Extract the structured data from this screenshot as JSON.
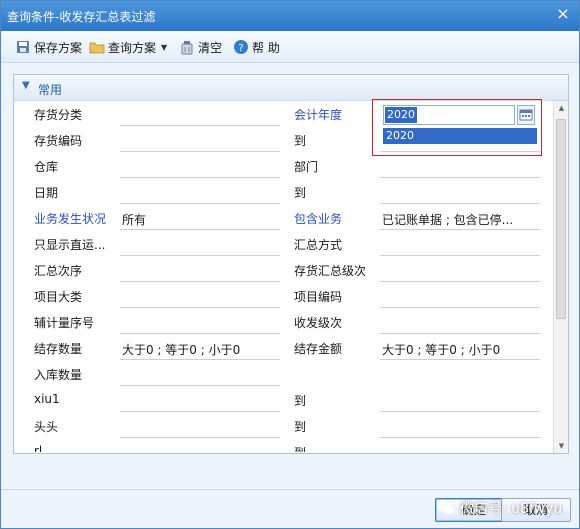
{
  "window": {
    "title": "查询条件-收发存汇总表过滤",
    "close_glyph": "×"
  },
  "toolbar": {
    "save_scheme": "保存方案",
    "query_scheme": "查询方案",
    "clear": "清空",
    "help": "帮 助"
  },
  "panel": {
    "title": "常用",
    "rows": [
      {
        "left_label": "存货分类",
        "left_value": "",
        "right_label": "会计年度",
        "right_value": "",
        "right_blue": true
      },
      {
        "left_label": "存货编码",
        "left_value": "",
        "right_label": "到",
        "right_value": ""
      },
      {
        "left_label": "仓库",
        "left_value": "",
        "right_label": "部门",
        "right_value": ""
      },
      {
        "left_label": "日期",
        "left_value": "",
        "right_label": "到",
        "right_value": ""
      },
      {
        "left_label": "业务发生状况",
        "left_value": "所有",
        "left_blue": true,
        "right_label": "包含业务",
        "right_value": "已记账单据 ; 包含已停...",
        "right_blue": true
      },
      {
        "left_label": "只显示直运...",
        "left_value": "",
        "right_label": "汇总方式",
        "right_value": ""
      },
      {
        "left_label": "汇总次序",
        "left_value": "",
        "right_label": "存货汇总级次",
        "right_value": ""
      },
      {
        "left_label": "项目大类",
        "left_value": "",
        "right_label": "项目编码",
        "right_value": ""
      },
      {
        "left_label": "辅计量序号",
        "left_value": "",
        "right_label": "收发级次",
        "right_value": ""
      },
      {
        "left_label": "结存数量",
        "left_value": "大于0 ; 等于0 ; 小于0",
        "right_label": "结存金额",
        "right_value": "大于0 ; 等于0 ; 小于0"
      },
      {
        "left_label": "入库数量",
        "left_value": "",
        "right_label": "",
        "right_value": ""
      },
      {
        "left_label": "xiu1",
        "left_value": "",
        "right_label": "到",
        "right_value": ""
      },
      {
        "left_label": "头头",
        "left_value": "",
        "right_label": "到",
        "right_value": ""
      },
      {
        "left_label": "rl",
        "left_value": "",
        "right_label": "到",
        "right_value": ""
      }
    ],
    "fiscal_year": {
      "input_value": "2020",
      "dropdown_option": "2020"
    }
  },
  "footer": {
    "ok": "确定",
    "cancel": "取消",
    "watermark": "微信号: u8fwyu"
  },
  "colors": {
    "accent": "#2d77c9",
    "highlight": "#e02020",
    "selection": "#3169c6",
    "label_blue": "#2a4fc4"
  },
  "icons": [
    "save-icon",
    "folder-icon",
    "clear-icon",
    "help-icon",
    "chevron-down-icon",
    "calendar-icon",
    "close-icon"
  ]
}
